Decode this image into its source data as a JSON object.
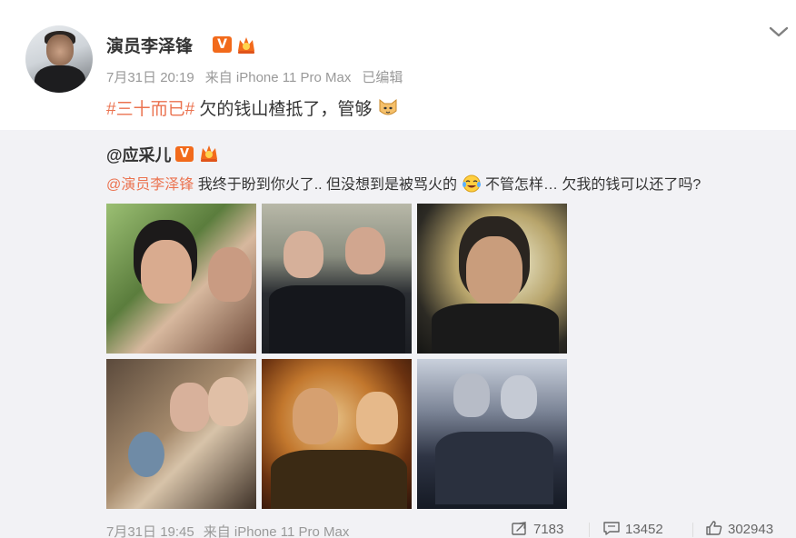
{
  "post": {
    "author": "演员李泽锋",
    "verified_badge": "V",
    "time": "7月31日 20:19",
    "source": "来自 iPhone 11 Pro Max",
    "edited": "已编辑",
    "hashtag": "#三十而已#",
    "text": " 欠的钱山楂抵了，管够",
    "emoji": "doge-cat-emoji"
  },
  "repost": {
    "author": "@应采儿",
    "verified_badge": "V",
    "mention": "@演员李泽锋",
    "text_part1": " 我终于盼到你火了.. 但没想到是被骂火的",
    "emoji": "laugh-cry-emoji",
    "text_part2": " 不管怎样… 欠我的钱可以还了吗?",
    "time": "7月31日 19:45",
    "source": "来自 iPhone 11 Pro Max",
    "stats": {
      "reposts": "7183",
      "comments": "13452",
      "likes": "302943"
    }
  },
  "colors": {
    "accent": "#eb7350",
    "badge": "#f26a1b",
    "repost_bg": "#f2f2f5",
    "meta_text": "#999999"
  }
}
